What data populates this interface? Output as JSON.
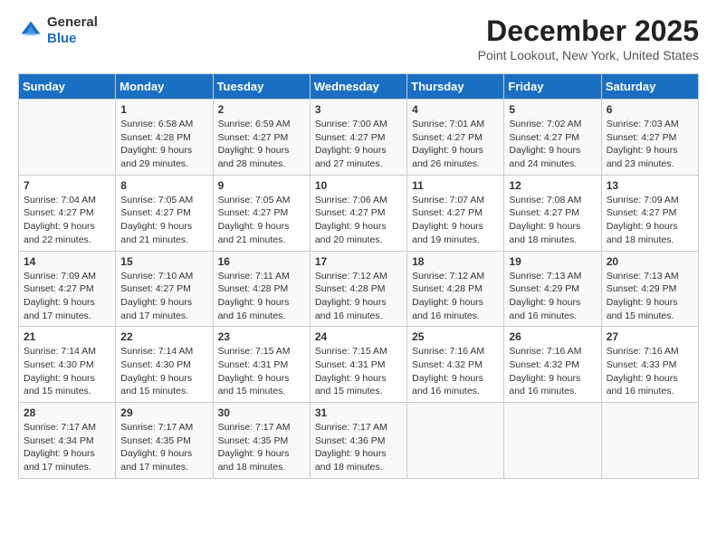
{
  "header": {
    "logo": {
      "general": "General",
      "blue": "Blue"
    },
    "title": "December 2025",
    "subtitle": "Point Lookout, New York, United States"
  },
  "calendar": {
    "days_of_week": [
      "Sunday",
      "Monday",
      "Tuesday",
      "Wednesday",
      "Thursday",
      "Friday",
      "Saturday"
    ],
    "weeks": [
      [
        {
          "day": "",
          "info": ""
        },
        {
          "day": "1",
          "info": "Sunrise: 6:58 AM\nSunset: 4:28 PM\nDaylight: 9 hours\nand 29 minutes."
        },
        {
          "day": "2",
          "info": "Sunrise: 6:59 AM\nSunset: 4:27 PM\nDaylight: 9 hours\nand 28 minutes."
        },
        {
          "day": "3",
          "info": "Sunrise: 7:00 AM\nSunset: 4:27 PM\nDaylight: 9 hours\nand 27 minutes."
        },
        {
          "day": "4",
          "info": "Sunrise: 7:01 AM\nSunset: 4:27 PM\nDaylight: 9 hours\nand 26 minutes."
        },
        {
          "day": "5",
          "info": "Sunrise: 7:02 AM\nSunset: 4:27 PM\nDaylight: 9 hours\nand 24 minutes."
        },
        {
          "day": "6",
          "info": "Sunrise: 7:03 AM\nSunset: 4:27 PM\nDaylight: 9 hours\nand 23 minutes."
        }
      ],
      [
        {
          "day": "7",
          "info": "Sunrise: 7:04 AM\nSunset: 4:27 PM\nDaylight: 9 hours\nand 22 minutes."
        },
        {
          "day": "8",
          "info": "Sunrise: 7:05 AM\nSunset: 4:27 PM\nDaylight: 9 hours\nand 21 minutes."
        },
        {
          "day": "9",
          "info": "Sunrise: 7:05 AM\nSunset: 4:27 PM\nDaylight: 9 hours\nand 21 minutes."
        },
        {
          "day": "10",
          "info": "Sunrise: 7:06 AM\nSunset: 4:27 PM\nDaylight: 9 hours\nand 20 minutes."
        },
        {
          "day": "11",
          "info": "Sunrise: 7:07 AM\nSunset: 4:27 PM\nDaylight: 9 hours\nand 19 minutes."
        },
        {
          "day": "12",
          "info": "Sunrise: 7:08 AM\nSunset: 4:27 PM\nDaylight: 9 hours\nand 18 minutes."
        },
        {
          "day": "13",
          "info": "Sunrise: 7:09 AM\nSunset: 4:27 PM\nDaylight: 9 hours\nand 18 minutes."
        }
      ],
      [
        {
          "day": "14",
          "info": "Sunrise: 7:09 AM\nSunset: 4:27 PM\nDaylight: 9 hours\nand 17 minutes."
        },
        {
          "day": "15",
          "info": "Sunrise: 7:10 AM\nSunset: 4:27 PM\nDaylight: 9 hours\nand 17 minutes."
        },
        {
          "day": "16",
          "info": "Sunrise: 7:11 AM\nSunset: 4:28 PM\nDaylight: 9 hours\nand 16 minutes."
        },
        {
          "day": "17",
          "info": "Sunrise: 7:12 AM\nSunset: 4:28 PM\nDaylight: 9 hours\nand 16 minutes."
        },
        {
          "day": "18",
          "info": "Sunrise: 7:12 AM\nSunset: 4:28 PM\nDaylight: 9 hours\nand 16 minutes."
        },
        {
          "day": "19",
          "info": "Sunrise: 7:13 AM\nSunset: 4:29 PM\nDaylight: 9 hours\nand 16 minutes."
        },
        {
          "day": "20",
          "info": "Sunrise: 7:13 AM\nSunset: 4:29 PM\nDaylight: 9 hours\nand 15 minutes."
        }
      ],
      [
        {
          "day": "21",
          "info": "Sunrise: 7:14 AM\nSunset: 4:30 PM\nDaylight: 9 hours\nand 15 minutes."
        },
        {
          "day": "22",
          "info": "Sunrise: 7:14 AM\nSunset: 4:30 PM\nDaylight: 9 hours\nand 15 minutes."
        },
        {
          "day": "23",
          "info": "Sunrise: 7:15 AM\nSunset: 4:31 PM\nDaylight: 9 hours\nand 15 minutes."
        },
        {
          "day": "24",
          "info": "Sunrise: 7:15 AM\nSunset: 4:31 PM\nDaylight: 9 hours\nand 15 minutes."
        },
        {
          "day": "25",
          "info": "Sunrise: 7:16 AM\nSunset: 4:32 PM\nDaylight: 9 hours\nand 16 minutes."
        },
        {
          "day": "26",
          "info": "Sunrise: 7:16 AM\nSunset: 4:32 PM\nDaylight: 9 hours\nand 16 minutes."
        },
        {
          "day": "27",
          "info": "Sunrise: 7:16 AM\nSunset: 4:33 PM\nDaylight: 9 hours\nand 16 minutes."
        }
      ],
      [
        {
          "day": "28",
          "info": "Sunrise: 7:17 AM\nSunset: 4:34 PM\nDaylight: 9 hours\nand 17 minutes."
        },
        {
          "day": "29",
          "info": "Sunrise: 7:17 AM\nSunset: 4:35 PM\nDaylight: 9 hours\nand 17 minutes."
        },
        {
          "day": "30",
          "info": "Sunrise: 7:17 AM\nSunset: 4:35 PM\nDaylight: 9 hours\nand 18 minutes."
        },
        {
          "day": "31",
          "info": "Sunrise: 7:17 AM\nSunset: 4:36 PM\nDaylight: 9 hours\nand 18 minutes."
        },
        {
          "day": "",
          "info": ""
        },
        {
          "day": "",
          "info": ""
        },
        {
          "day": "",
          "info": ""
        }
      ]
    ]
  }
}
